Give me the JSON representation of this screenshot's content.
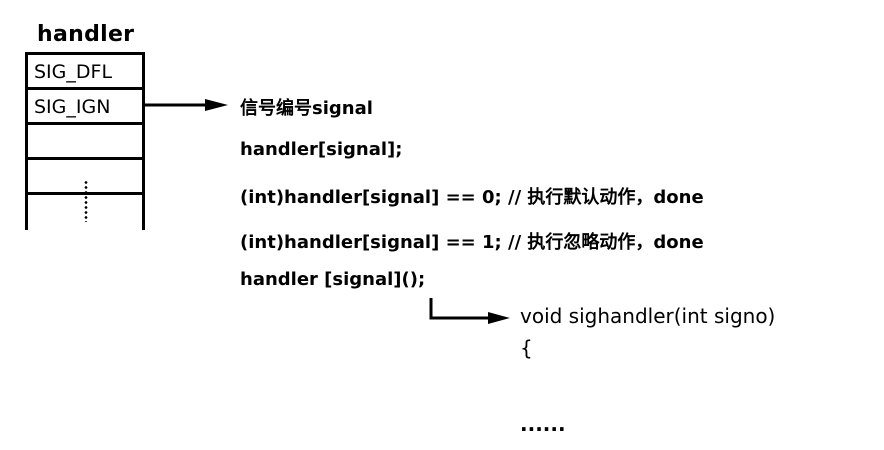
{
  "table": {
    "header": "handler",
    "rows": [
      "SIG_DFL",
      "SIG_IGN",
      "",
      ""
    ],
    "ellipsis": "⋮"
  },
  "code_lines": [
    "信号编号signal",
    "handler[signal];",
    "(int)handler[signal] == 0; // 执行默认动作，done",
    "(int)handler[signal] == 1; // 执行忽略动作，done",
    "handler [signal]();"
  ],
  "sighandler": {
    "signature": "void sighandler(int signo)",
    "open_brace": "{",
    "body": "......"
  }
}
